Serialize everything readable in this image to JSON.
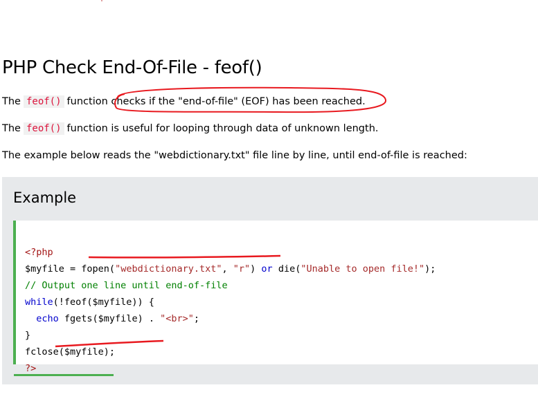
{
  "heading": "PHP Check End-Of-File - feof()",
  "paragraph1": {
    "prefix": "The",
    "code": "feof()",
    "word": "function",
    "rest": "checks if the \"end-of-file\" (EOF) has been reached."
  },
  "paragraph2": {
    "prefix": "The",
    "code": "feof()",
    "rest": "function is useful for looping through data of unknown length."
  },
  "paragraph3": "The example below reads the \"webdictionary.txt\" file line by line, until end-of-file is reached:",
  "example": {
    "title": "Example",
    "code": {
      "l1": "<?php",
      "l2_var": "$myfile = ",
      "l2_fn": "fopen(",
      "l2_str1": "\"webdictionary.txt\"",
      "l2_sep": ", ",
      "l2_str2": "\"r\"",
      "l2_close": ") ",
      "l2_or": "or",
      "l2_die": " die(",
      "l2_str3": "\"Unable to open file!\"",
      "l2_end": ");",
      "l3": "// Output one line until end-of-file",
      "l4_kw": "while",
      "l4_rest": "(!feof($myfile)) {",
      "l5_kw": "  echo",
      "l5_mid": " fgets($myfile) . ",
      "l5_str": "\"<br>\"",
      "l5_end": ";",
      "l6": "}",
      "l7": "fclose($myfile);",
      "l8": "?>"
    }
  },
  "annotation_color": "#e8191f",
  "accent_green": "#4caf50"
}
